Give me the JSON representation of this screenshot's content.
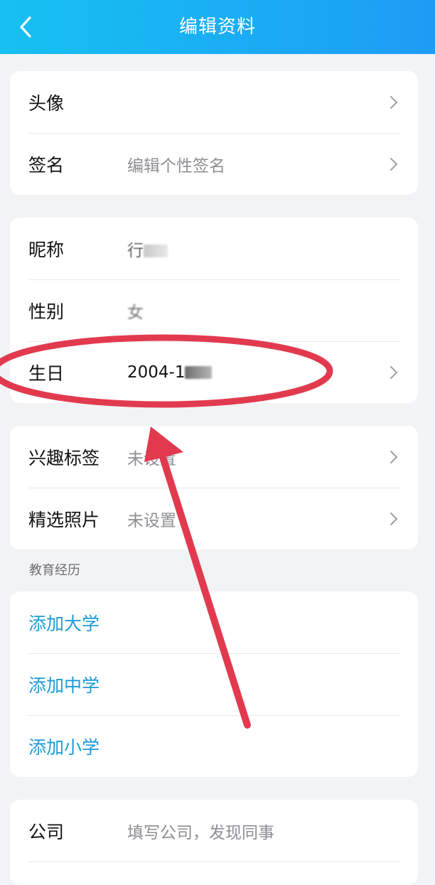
{
  "header": {
    "title": "编辑资料",
    "back_icon": "chevron-left-icon"
  },
  "card1": {
    "avatar_label": "头像",
    "signature_label": "签名",
    "signature_placeholder": "编辑个性签名"
  },
  "card2": {
    "nickname_label": "昵称",
    "nickname_value_partial": "行",
    "gender_label": "性别",
    "gender_value_partial": "女",
    "birthday_label": "生日",
    "birthday_value_partial": "2004-1"
  },
  "card3": {
    "interests_label": "兴趣标签",
    "interests_value": "未设置",
    "photos_label": "精选照片",
    "photos_value": "未设置"
  },
  "education": {
    "section_title": "教育经历",
    "add_university": "添加大学",
    "add_middle_school": "添加中学",
    "add_primary_school": "添加小学"
  },
  "company": {
    "label": "公司",
    "placeholder": "填写公司，发现同事"
  },
  "colors": {
    "header_start": "#16c1f2",
    "header_end": "#1e9cf5",
    "link": "#1a9cd8",
    "annotation": "#e13a4f"
  }
}
